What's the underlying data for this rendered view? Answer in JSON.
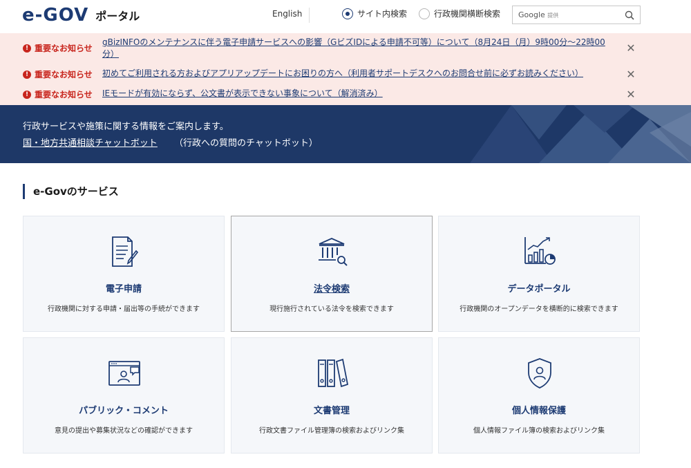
{
  "header": {
    "logo_mark": "e-GOV",
    "logo_text": "ポータル",
    "english_link": "English",
    "search_scope": [
      {
        "label": "サイト内検索",
        "selected": true
      },
      {
        "label": "行政機関横断検索",
        "selected": false
      }
    ],
    "search": {
      "value": "",
      "brand": "Google",
      "brand_suffix": "提供"
    }
  },
  "notices": [
    {
      "tag": "重要なお知らせ",
      "message": "gBizINFOのメンテナンスに伴う電子申請サービスへの影響（GビズIDによる申請不可等）について（8月24日（月）9時00分～22時00分）"
    },
    {
      "tag": "重要なお知らせ",
      "message": "初めてご利用される方およびアプリアップデートにお困りの方へ（利用者サポートデスクへのお問合せ前に必ずお読みください）"
    },
    {
      "tag": "重要なお知らせ",
      "message": "IEモードが有効にならず、公文書が表示できない事象について（解消済み）"
    }
  ],
  "banner": {
    "lead": "行政サービスや施策に関する情報をご案内します。",
    "chat_link": "国・地方共通相談チャットボット",
    "chat_note": "（行政への質問のチャットボット）"
  },
  "services": {
    "title": "e-Govのサービス",
    "cards": [
      {
        "title": "電子申請",
        "description": "行政機関に対する申請・届出等の手続ができます",
        "icon": "document-pen-icon"
      },
      {
        "title": "法令検索",
        "description": "現行施行されている法令を検索できます",
        "icon": "building-search-icon"
      },
      {
        "title": "データポータル",
        "description": "行政機関のオープンデータを横断的に検索できます",
        "icon": "chart-icon"
      },
      {
        "title": "パブリック・コメント",
        "description": "意見の提出や募集状況などの確認ができます",
        "icon": "comment-monitor-icon"
      },
      {
        "title": "文書管理",
        "description": "行政文書ファイル管理簿の検索およびリンク集",
        "icon": "binders-icon"
      },
      {
        "title": "個人情報保護",
        "description": "個人情報ファイル簿の検索およびリンク集",
        "icon": "shield-person-icon"
      }
    ]
  },
  "colors": {
    "brand": "#1d3b73",
    "alert": "#c8251d",
    "notice_bg": "#fbe9e6",
    "banner_bg": "#1e3867"
  }
}
